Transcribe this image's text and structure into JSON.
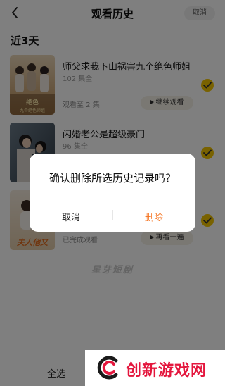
{
  "header": {
    "title": "观看历史",
    "cancel_label": "取消"
  },
  "section_label": "近3天",
  "history": [
    {
      "title": "师父求我下山祸害九个绝色师姐",
      "episodes": "102 集全",
      "progress": "观看至 2 集",
      "action_label": "继续观看",
      "checked": true,
      "poster_text": "九个绝色师姐"
    },
    {
      "title": "闪婚老公是超级豪门",
      "episodes": "96 集全",
      "progress": "",
      "action_label": "",
      "checked": true
    },
    {
      "title": "",
      "episodes": "",
      "progress": "已完成观看",
      "action_label": "再看一遍",
      "checked": true,
      "poster_text": "夫人他又"
    }
  ],
  "brand": "星芽短剧",
  "bottom": {
    "select_all": "全选"
  },
  "dialog": {
    "title": "确认删除所选历史记录吗？",
    "cancel": "取消",
    "delete": "删除"
  },
  "watermark": {
    "text": "创新游戏网"
  },
  "colors": {
    "accent": "#f2c500",
    "delete": "#f5731f",
    "watermark": "#e4163d"
  }
}
